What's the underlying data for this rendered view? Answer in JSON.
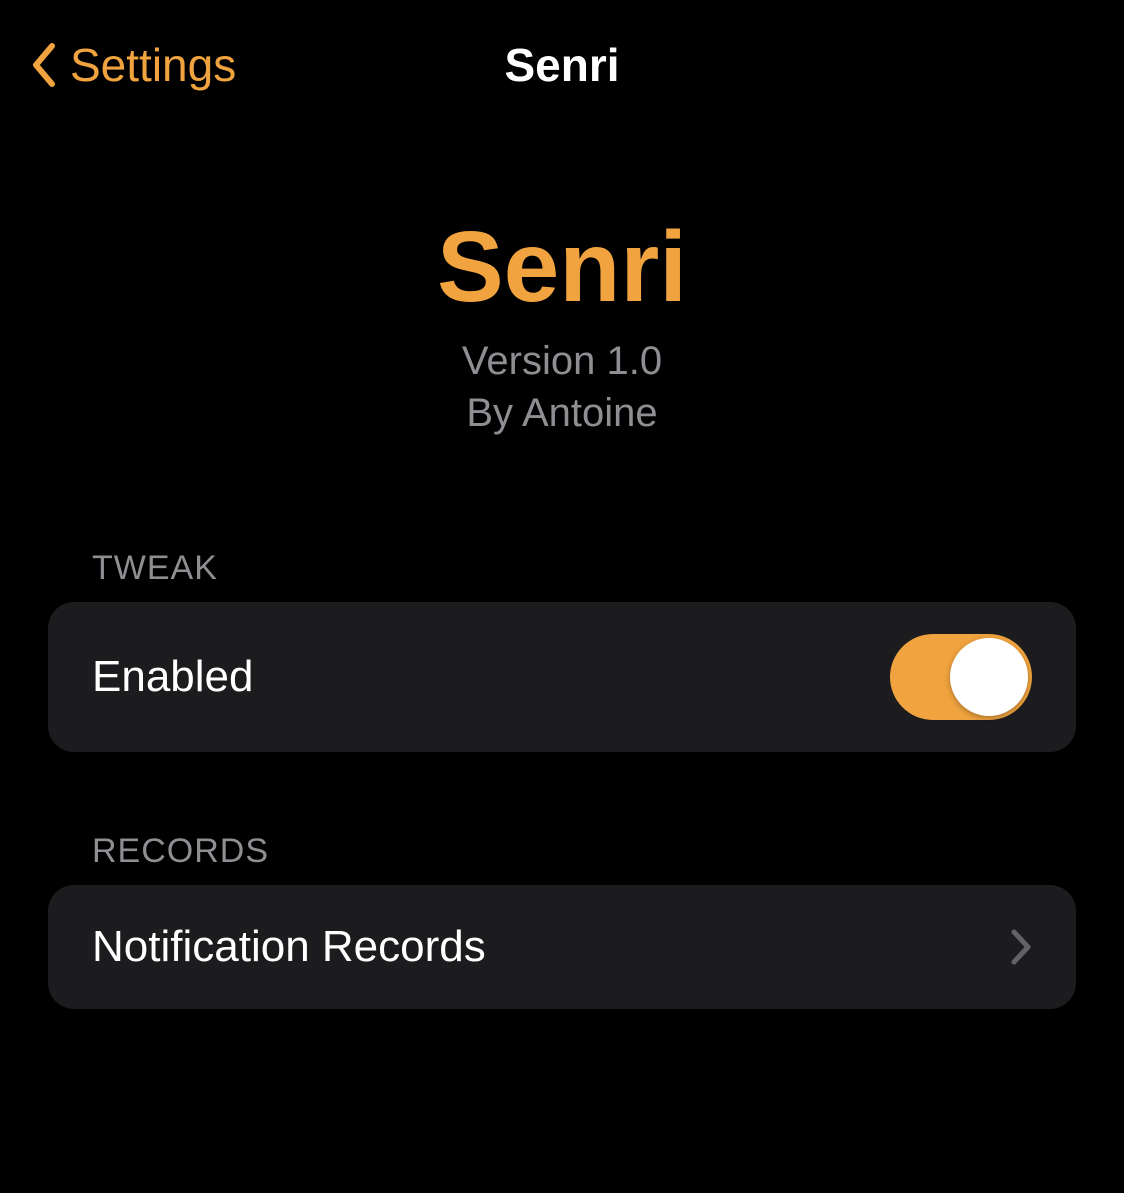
{
  "nav": {
    "back_label": "Settings",
    "title": "Senri"
  },
  "hero": {
    "title": "Senri",
    "version": "Version 1.0",
    "author": "By Antoine"
  },
  "sections": {
    "tweak": {
      "header": "TWEAK",
      "enabled_label": "Enabled",
      "enabled_value": true
    },
    "records": {
      "header": "RECORDS",
      "notification_records_label": "Notification Records"
    }
  },
  "colors": {
    "accent": "#F0A33E",
    "cell_background": "#1C1C1E",
    "secondary_text": "#8E8E93"
  }
}
